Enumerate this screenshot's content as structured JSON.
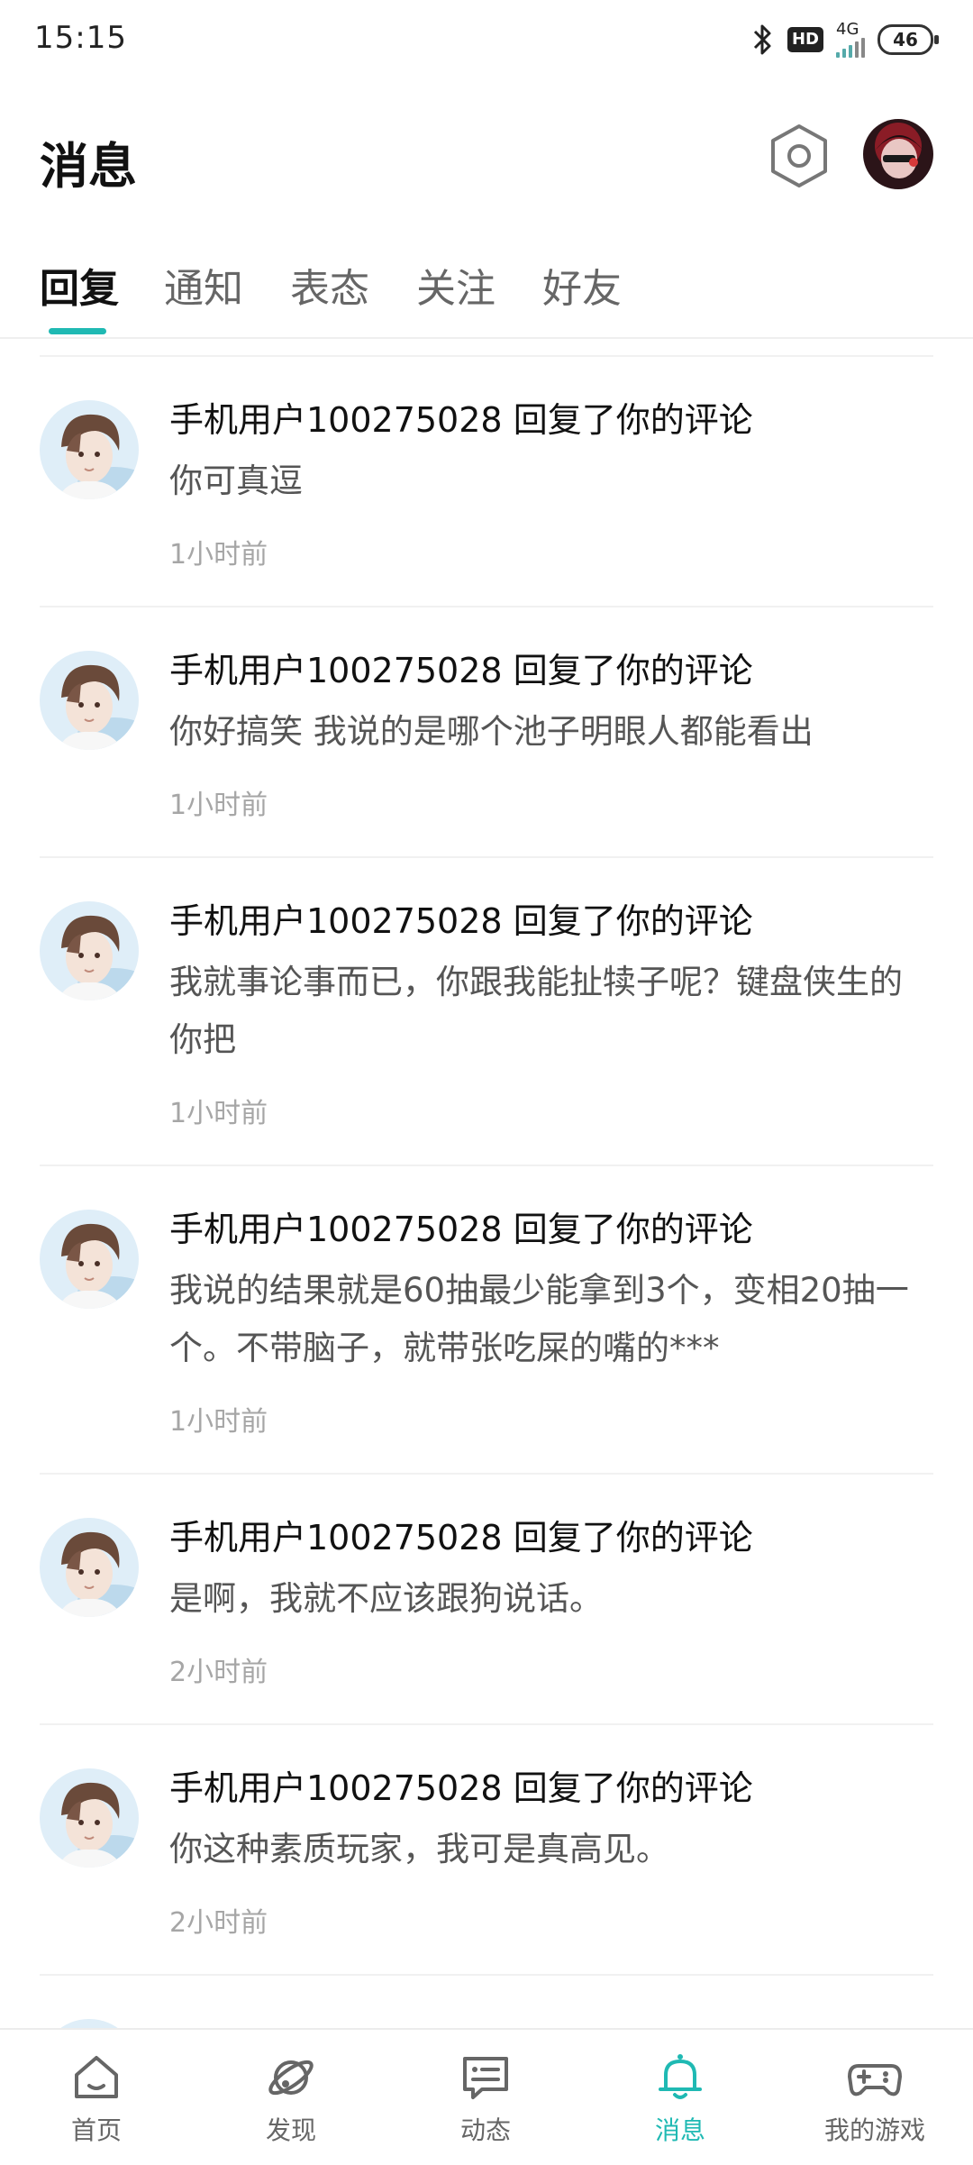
{
  "status_bar": {
    "time": "15:15",
    "icons": [
      "bluetooth-icon",
      "hd-icon",
      "signal-icon",
      "battery-icon"
    ],
    "hd": "HD",
    "network": "4G",
    "battery": "46"
  },
  "header": {
    "title": "消息",
    "settings_icon": "settings-icon",
    "avatar": "user-avatar"
  },
  "tabs": [
    {
      "label": "回复",
      "active": true
    },
    {
      "label": "通知",
      "active": false
    },
    {
      "label": "表态",
      "active": false
    },
    {
      "label": "关注",
      "active": false
    },
    {
      "label": "好友",
      "active": false
    }
  ],
  "messages": [
    {
      "user": "手机用户100275028",
      "action": "回复了你的评论",
      "content": "你可真逗",
      "time": "1小时前"
    },
    {
      "user": "手机用户100275028",
      "action": "回复了你的评论",
      "content": "你好搞笑 我说的是哪个池子明眼人都能看出",
      "time": "1小时前"
    },
    {
      "user": "手机用户100275028",
      "action": "回复了你的评论",
      "content": "我就事论事而已，你跟我能扯犊子呢？键盘侠生的你把",
      "time": "1小时前"
    },
    {
      "user": "手机用户100275028",
      "action": "回复了你的评论",
      "content": "我说的结果就是60抽最少能拿到3个，变相20抽一个。不带脑子，就带张吃屎的嘴的***",
      "time": "1小时前"
    },
    {
      "user": "手机用户100275028",
      "action": "回复了你的评论",
      "content": "是啊，我就不应该跟狗说话。",
      "time": "2小时前"
    },
    {
      "user": "手机用户100275028",
      "action": "回复了你的评论",
      "content": "你这种素质玩家，我可是真高见。",
      "time": "2小时前"
    }
  ],
  "bottom_nav": [
    {
      "label": "首页",
      "icon": "home-icon",
      "active": false
    },
    {
      "label": "发现",
      "icon": "planet-icon",
      "active": false
    },
    {
      "label": "动态",
      "icon": "feed-icon",
      "active": false
    },
    {
      "label": "消息",
      "icon": "bell-icon",
      "active": true
    },
    {
      "label": "我的游戏",
      "icon": "gamepad-icon",
      "active": false
    }
  ],
  "colors": {
    "accent": "#1fb9b3",
    "text": "#111111",
    "secondary": "#555555",
    "muted": "#a6a6a6"
  }
}
